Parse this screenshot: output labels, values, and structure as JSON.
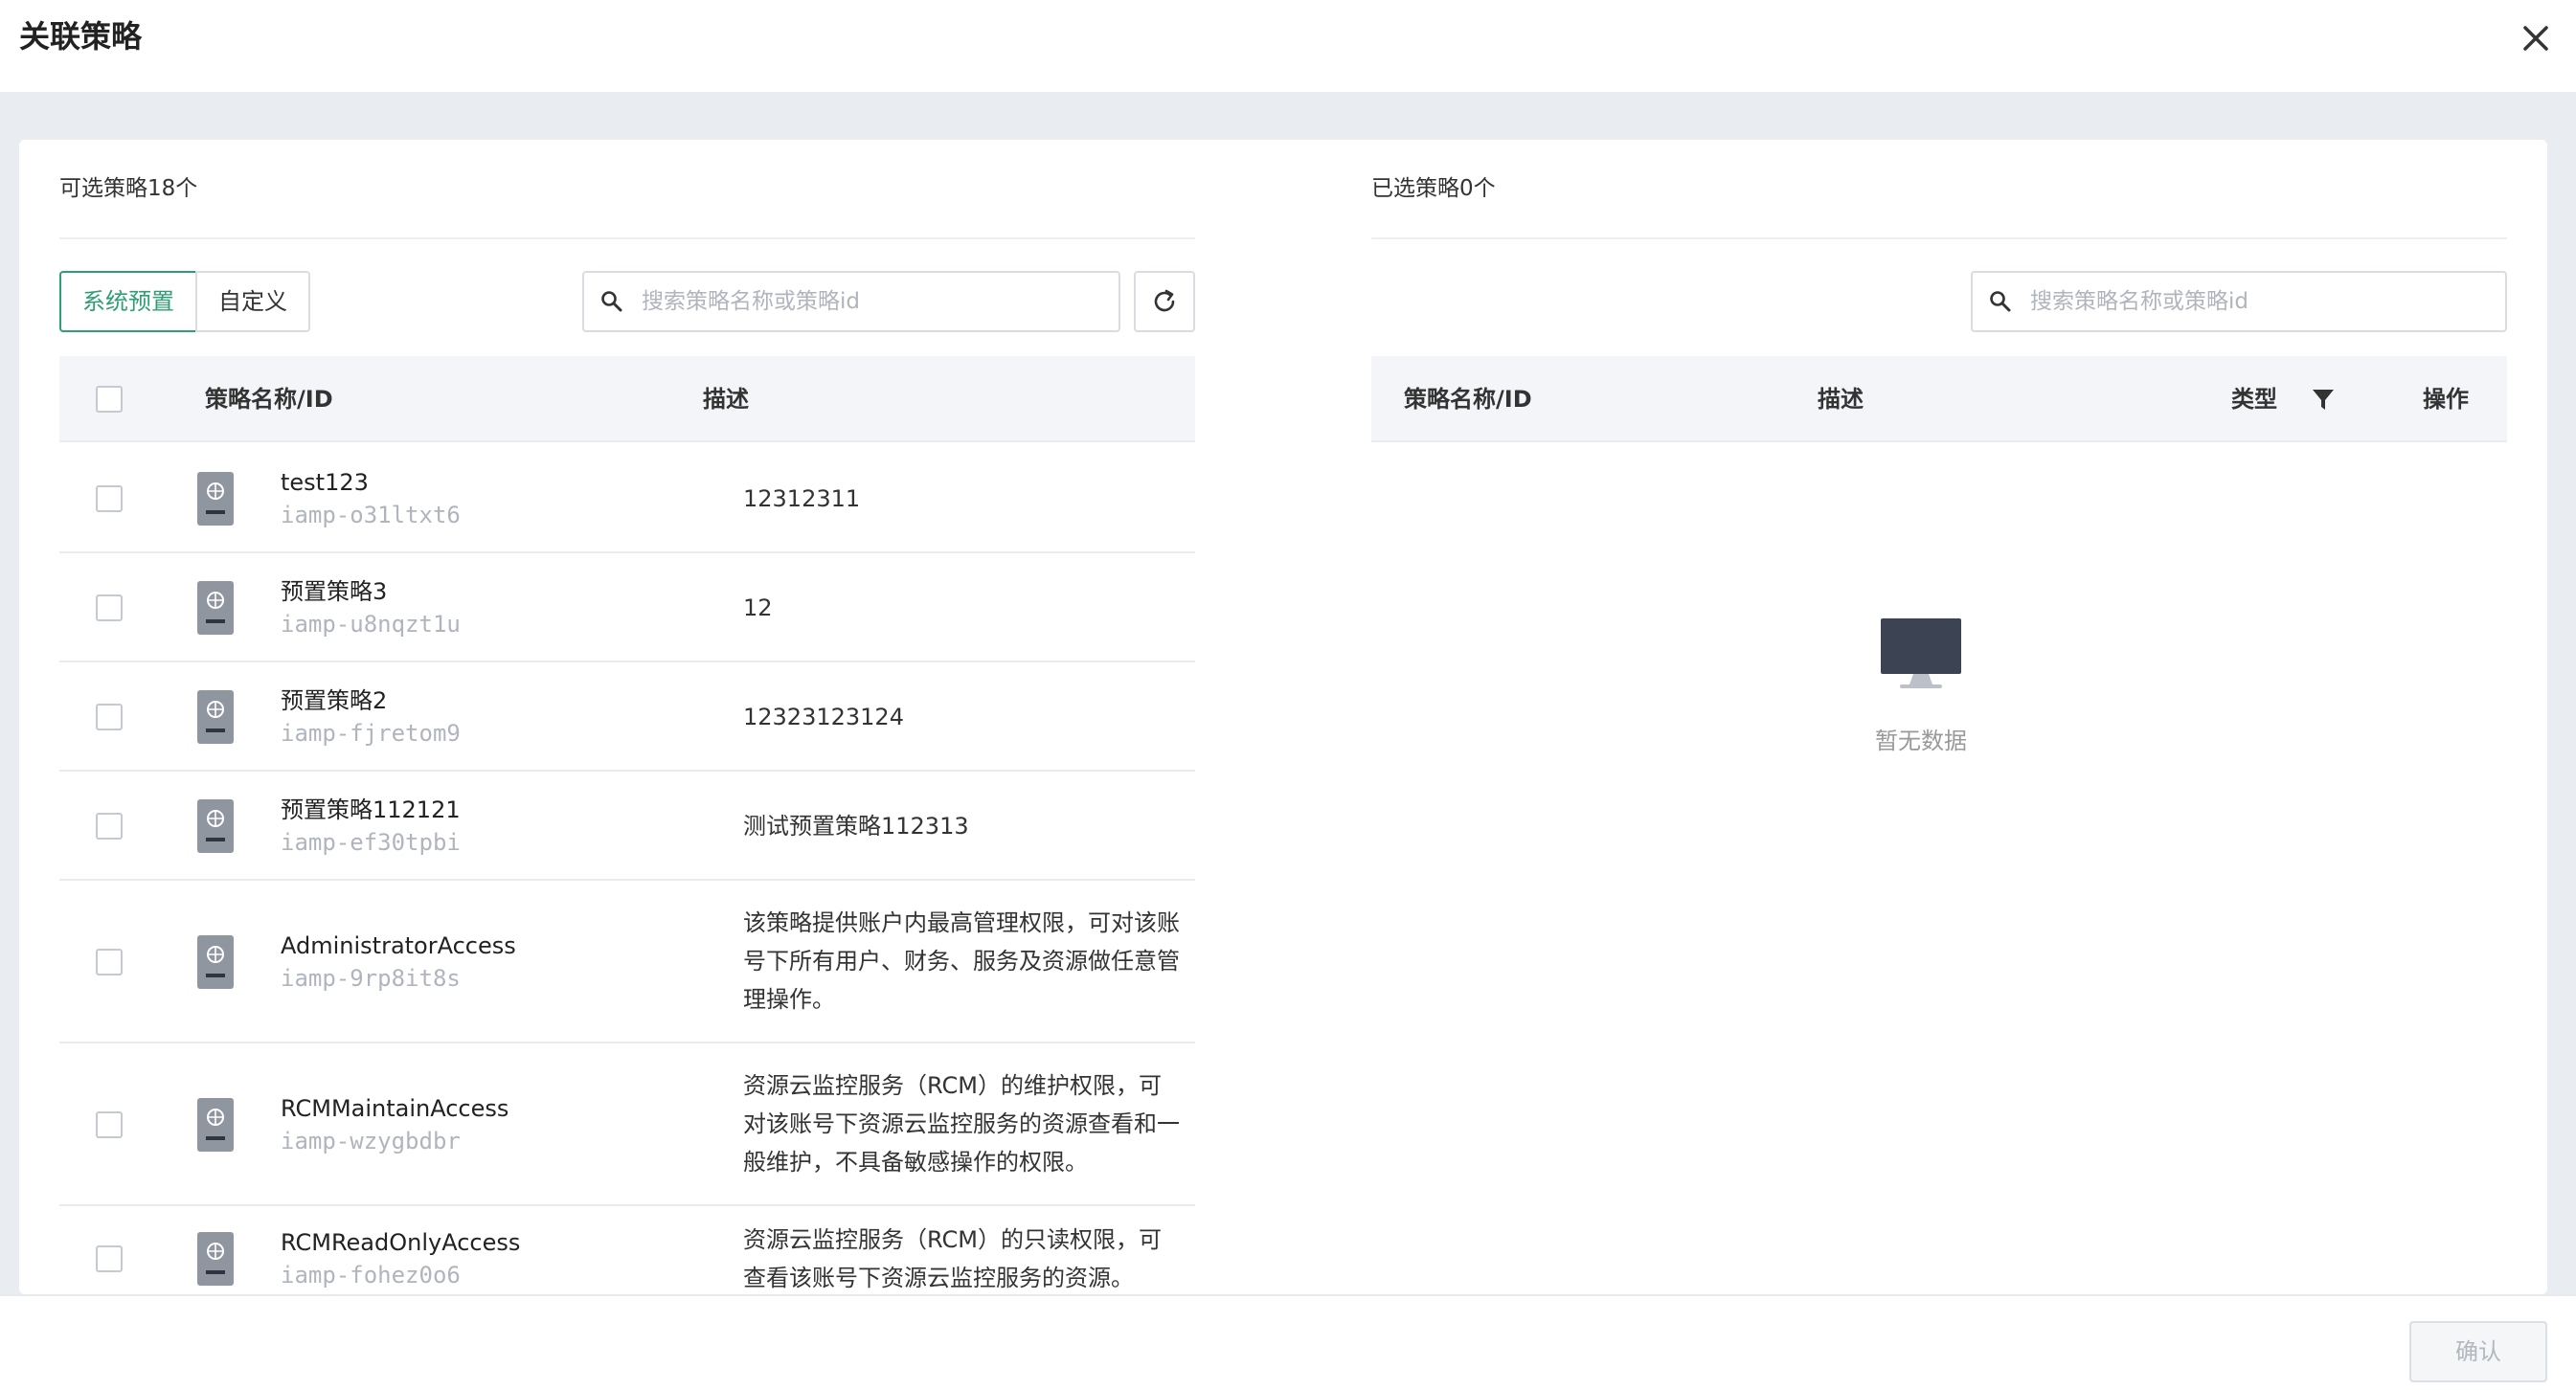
{
  "dialog": {
    "title": "关联策略",
    "close_icon": "close-icon"
  },
  "left_panel": {
    "title": "可选策略18个",
    "tabs": [
      {
        "label": "系统预置",
        "active": true
      },
      {
        "label": "自定义",
        "active": false
      }
    ],
    "search": {
      "placeholder": "搜索策略名称或策略id",
      "value": ""
    },
    "refresh_icon": "refresh-icon",
    "columns": {
      "name": "策略名称/ID",
      "desc": "描述"
    },
    "rows": [
      {
        "name": "test123",
        "id": "iamp-o31ltxt6",
        "desc": "12312311"
      },
      {
        "name": "预置策略3",
        "id": "iamp-u8nqzt1u",
        "desc": "12"
      },
      {
        "name": "预置策略2",
        "id": "iamp-fjretom9",
        "desc": "12323123124"
      },
      {
        "name": "预置策略112121",
        "id": "iamp-ef30tpbi",
        "desc": "测试预置策略112313"
      },
      {
        "name": "AdministratorAccess",
        "id": "iamp-9rp8it8s",
        "desc": "该策略提供账户内最高管理权限，可对该账号下所有用户、财务、服务及资源做任意管理操作。"
      },
      {
        "name": "RCMMaintainAccess",
        "id": "iamp-wzygbdbr",
        "desc": "资源云监控服务（RCM）的维护权限，可对该账号下资源云监控服务的资源查看和一般维护，不具备敏感操作的权限。"
      },
      {
        "name": "RCMReadOnlyAccess",
        "id": "iamp-fohez0o6",
        "desc": "资源云监控服务（RCM）的只读权限，可查看该账号下资源云监控服务的资源。"
      }
    ]
  },
  "right_panel": {
    "title": "已选策略0个",
    "search": {
      "placeholder": "搜索策略名称或策略id",
      "value": ""
    },
    "columns": {
      "name": "策略名称/ID",
      "desc": "描述",
      "type": "类型",
      "action": "操作"
    },
    "filter_icon": "filter-icon",
    "empty_icon": "monitor-icon",
    "empty_text": "暂无数据"
  },
  "footer": {
    "confirm_label": "确认"
  },
  "colors": {
    "accent": "#2e9e74",
    "border": "#d9dde3",
    "header_bg": "#f3f5f8",
    "page_bg": "#e9edf2"
  }
}
